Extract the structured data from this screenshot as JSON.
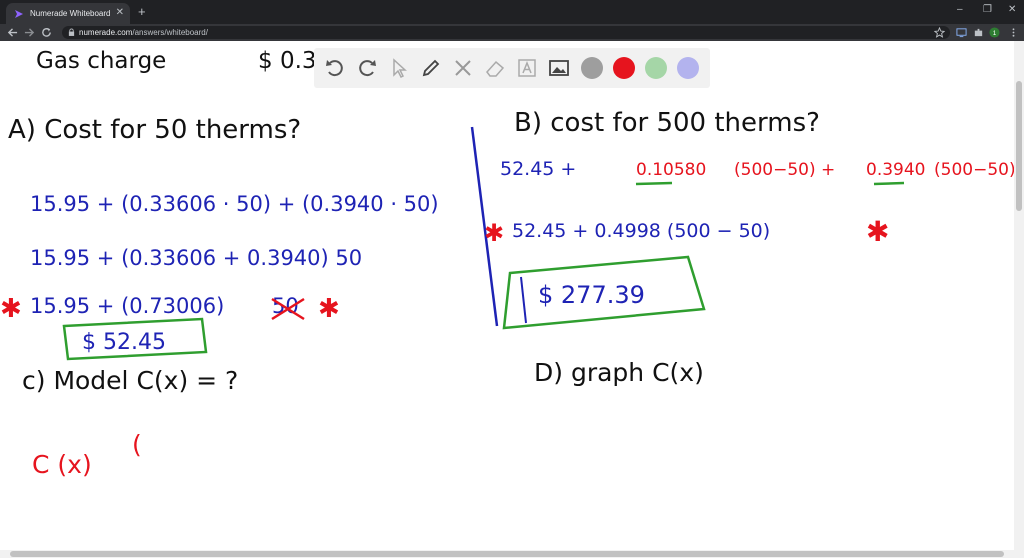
{
  "browser": {
    "tab_title": "Numerade Whiteboard",
    "tab_close": "✕",
    "new_tab": "+",
    "url_host": "numerade.com",
    "url_path": "/answers/whiteboard/",
    "window": {
      "minimize": "–",
      "maximize": "❐",
      "close": "✕"
    },
    "avatar_letter": "1",
    "colors": {
      "frame": "#202124",
      "toolbar": "#35363a",
      "text": "#bdc1c6"
    }
  },
  "board": {
    "top_line": {
      "gas_charge": "Gas charge",
      "gas_value": "$ 0.3"
    },
    "partA": {
      "heading": "A) Cost for 50 therms?",
      "line1": "15.95 + (0.33606 · 50) + (0.3940 · 50)",
      "line2": "15.95 + (0.33606 + 0.3940) 50",
      "line3": "15.95 + (0.73006)",
      "line3_struck": "50",
      "answer": "$ 52.45"
    },
    "partB": {
      "heading": "B) cost for 500 therms?",
      "line1_start": "52.45 +",
      "line1_a": "0.10580",
      "line1_b": "(500−50) +",
      "line1_c": "0.3940",
      "line1_d": "(500−50)",
      "line2": "52.45 + 0.4998 (500 − 50)",
      "answer": "$ 277.39"
    },
    "partC": {
      "heading": "c) Model C(x) = ?",
      "expr": "C (x)",
      "partial": "("
    },
    "partD": {
      "heading": "D) graph C(x)"
    },
    "star": "✱",
    "colors": {
      "blue_ink": "#1e23b4",
      "red_ink": "#e6141e",
      "green_ink": "#2f9e2f",
      "toolbar": "#f1f1f1"
    }
  },
  "tools": {
    "items": [
      "undo-icon",
      "redo-icon",
      "pointer-icon",
      "pen-icon",
      "tools-icon",
      "eraser-icon",
      "text-icon",
      "image-icon"
    ],
    "colors": [
      "#9e9e9e",
      "#e6141e",
      "#a5d6a7",
      "#b3b3ee"
    ]
  }
}
